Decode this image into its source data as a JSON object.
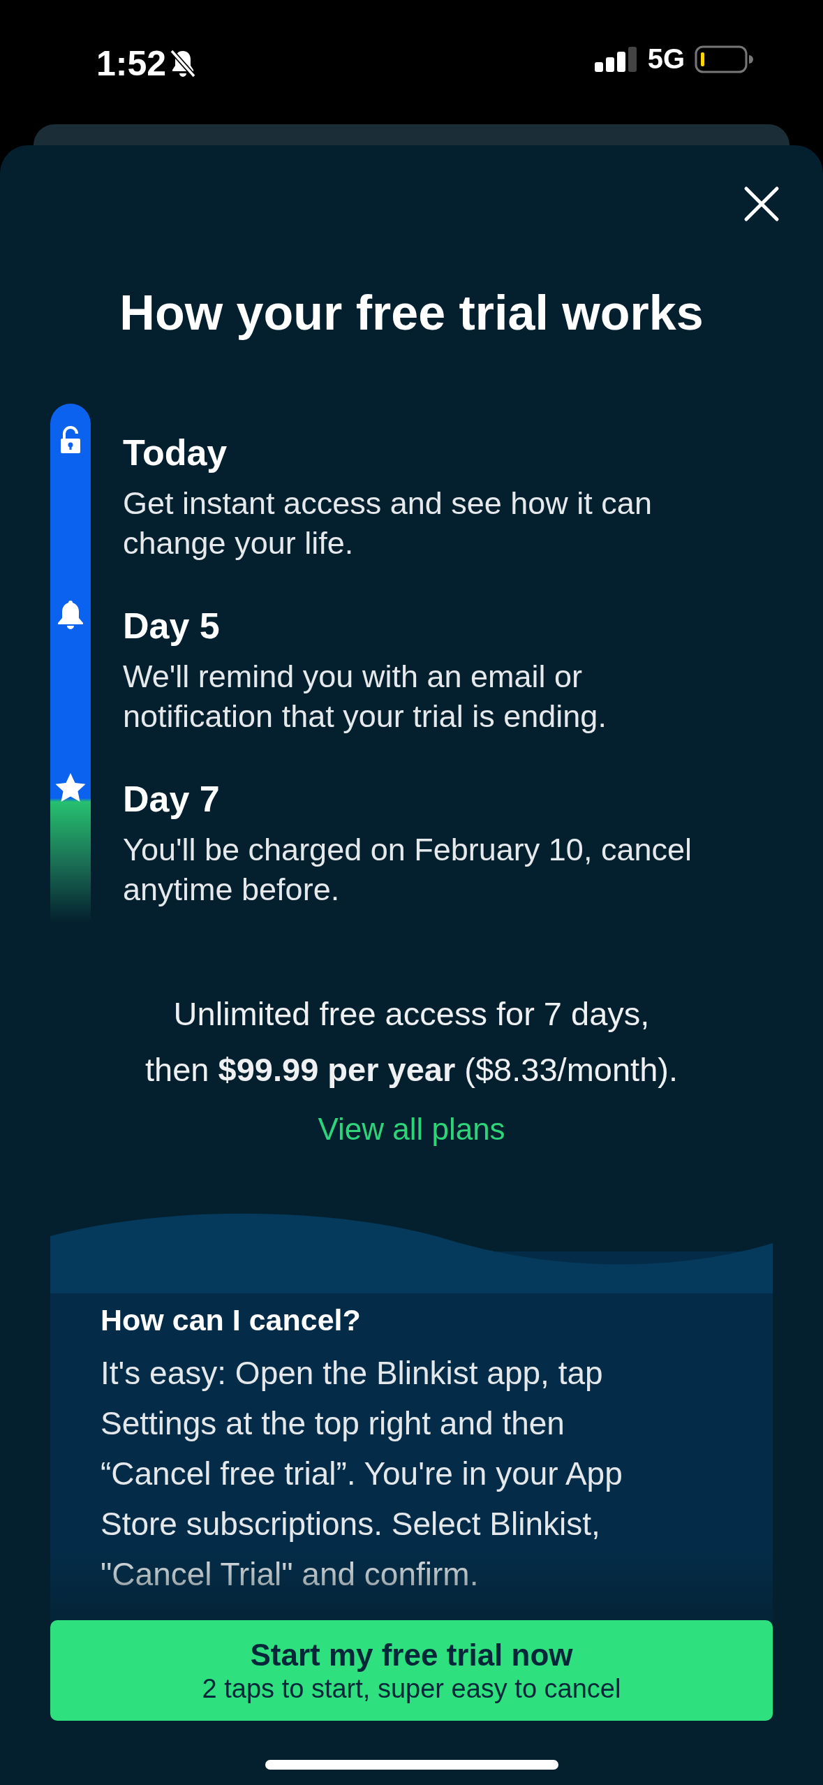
{
  "status_bar": {
    "time": "1:52",
    "silent": true,
    "network": "5G"
  },
  "sheet": {
    "title": "How your free trial works",
    "steps": [
      {
        "kind": "lock",
        "title": "Today",
        "text": "Get instant access and see how it can change your life."
      },
      {
        "kind": "bell",
        "title": "Day 5",
        "text": "We'll remind you with an email or notification that your trial is ending."
      },
      {
        "kind": "star",
        "title": "Day 7",
        "text": "You'll be charged on February 10, cancel anytime before."
      }
    ],
    "price_text": "Unlimited free access for 7 days, then **$99.99 per year** ($8.33/month).",
    "plans_link": "View all plans",
    "faq": {
      "question": "How can I cancel?",
      "answer": "It's easy: Open the Blinkist app, tap Settings at the top right and then “Cancel free trial”. You're in your App Store subscriptions. Select Blinkist, \"Cancel Trial\" and confirm."
    },
    "cta": {
      "title": "Start my free trial now",
      "subtitle": "2 taps to start, super easy to cancel"
    }
  }
}
